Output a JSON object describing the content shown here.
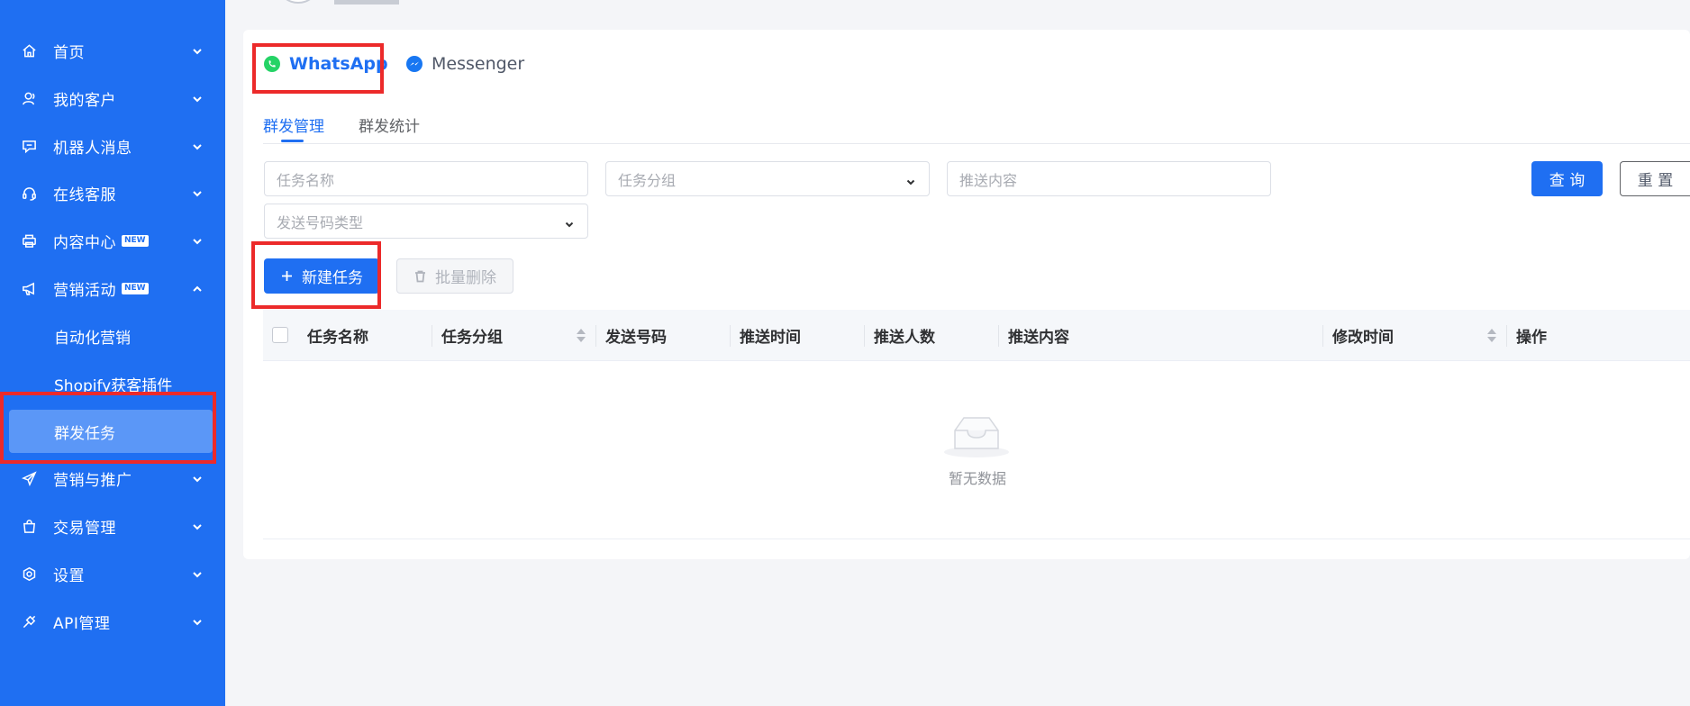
{
  "sidebar": {
    "items": [
      {
        "label": "首页",
        "icon": "home-icon"
      },
      {
        "label": "我的客户",
        "icon": "user-icon"
      },
      {
        "label": "机器人消息",
        "icon": "chat-icon"
      },
      {
        "label": "在线客服",
        "icon": "headset-icon"
      },
      {
        "label": "内容中心",
        "icon": "printer-icon",
        "badge": "NEW"
      },
      {
        "label": "营销活动",
        "icon": "megaphone-icon",
        "badge": "NEW"
      },
      {
        "label": "营销与推广",
        "icon": "paper-plane-icon"
      },
      {
        "label": "交易管理",
        "icon": "shopping-bag-icon"
      },
      {
        "label": "设置",
        "icon": "settings-icon"
      },
      {
        "label": "API管理",
        "icon": "api-plug-icon"
      }
    ],
    "sub_items": [
      {
        "label": "自动化营销"
      },
      {
        "label": "Shopify获客插件"
      },
      {
        "label": "群发任务"
      }
    ],
    "active_sub": "群发任务"
  },
  "channels": {
    "whatsapp": "WhatsApp",
    "messenger": "Messenger"
  },
  "tabs": {
    "manage": "群发管理",
    "stats": "群发统计"
  },
  "filters": {
    "task_name_placeholder": "任务名称",
    "task_group_placeholder": "任务分组",
    "push_content_placeholder": "推送内容",
    "number_type_placeholder": "发送号码类型"
  },
  "buttons": {
    "query": "查 询",
    "reset": "重 置",
    "new_task": "新建任务",
    "batch_delete": "批量删除"
  },
  "table": {
    "columns": [
      "任务名称",
      "任务分组",
      "发送号码",
      "推送时间",
      "推送人数",
      "推送内容",
      "修改时间",
      "操作"
    ],
    "empty_text": "暂无数据"
  },
  "colors": {
    "sidebar": "#1f6ff2",
    "accent": "#1f6ff2",
    "active_sub": "#5b97f7",
    "highlight": "#ec2a2a",
    "whatsapp": "#25d366",
    "messenger": "#1877f2"
  }
}
